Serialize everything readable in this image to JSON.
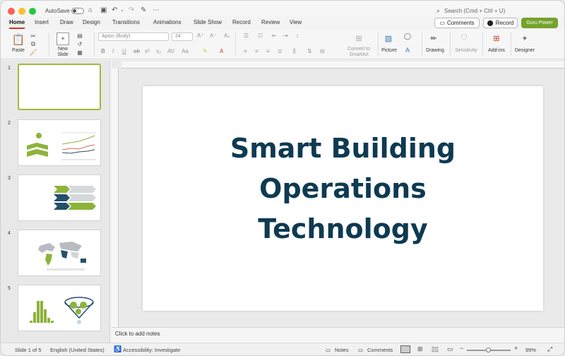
{
  "titlebar": {
    "autosave_label": "AutoSave",
    "search_placeholder": "Search (Cmd + Ctrl + U)"
  },
  "tabs": [
    "Home",
    "Insert",
    "Draw",
    "Design",
    "Transitions",
    "Animations",
    "Slide Show",
    "Record",
    "Review",
    "View"
  ],
  "active_tab": "Home",
  "top_buttons": {
    "comments": "Comments",
    "record": "Record",
    "guru": "Guru Power"
  },
  "ribbon": {
    "paste": "Paste",
    "new_slide_line1": "New",
    "new_slide_line2": "Slide",
    "font_name": "Aptos (Body)",
    "font_size": "24",
    "convert_line1": "Convert to",
    "convert_line2": "SmartArt",
    "picture": "Picture",
    "drawing": "Drawing",
    "sensitivity": "Sensitivity",
    "addins": "Add-ins",
    "designer": "Designer"
  },
  "slides": [
    {
      "number": "1"
    },
    {
      "number": "2"
    },
    {
      "number": "3"
    },
    {
      "number": "4"
    },
    {
      "number": "5"
    }
  ],
  "slide_title": {
    "line1": "Smart Building",
    "line2": "Operations",
    "line3": "Technology"
  },
  "notes_placeholder": "Click to add notes",
  "status": {
    "slide_count": "Slide 1 of 5",
    "language": "English (United States)",
    "accessibility": "Accessibility: Investigate",
    "notes": "Notes",
    "comments": "Comments",
    "zoom": "99%"
  },
  "colors": {
    "accent_tab": "#c43e1c",
    "guru_button": "#74a32c",
    "title_text": "#0e3a52",
    "thumb_green": "#8db33a",
    "thumb_navy": "#23506b"
  }
}
